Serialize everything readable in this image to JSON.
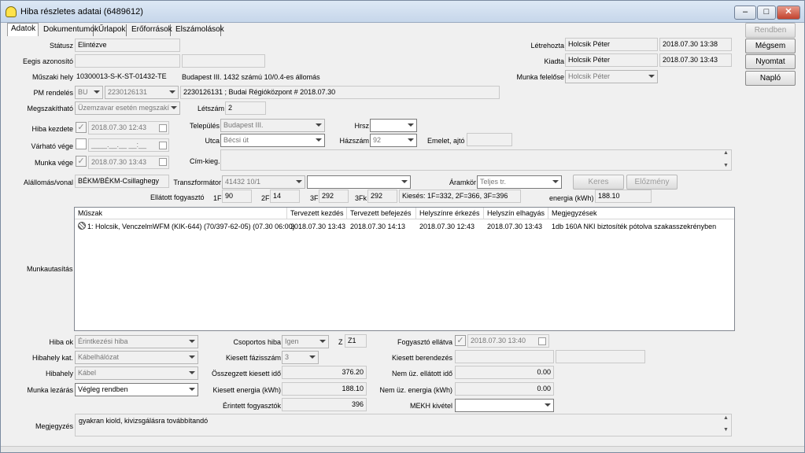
{
  "window": {
    "title": "Hiba részletes adatai (6489612)",
    "minimize": "–",
    "maximize": "□",
    "close": "✕"
  },
  "tabs": [
    "Adatok",
    "Dokumentumok",
    "Űrlapok",
    "Erőforrások",
    "Elszámolások"
  ],
  "side_buttons": {
    "ok": "Rendben",
    "cancel": "Mégsem",
    "print": "Nyomtat",
    "log": "Napló"
  },
  "form": {
    "status_label": "Státusz",
    "status_value": "Elintézve",
    "unique_id_label": "Eegis azonosító",
    "unique_id_value": "",
    "tech_place_label": "Műszaki hely",
    "tech_place_code": "10300013-S-K-ST-01432-TE",
    "tech_place_desc": "Budapest III. 1432 számú 10/0.4-es állomás",
    "pm_order_label": "PM rendelés",
    "pm_order_prefix": "BU",
    "pm_order_number": "2230126131",
    "pm_order_desc": "2230126131 ; Budai Régióközpont # 2018.07.30",
    "interruptible_label": "Megszakítható",
    "interruptible_value": "Üzemzavar esetén megszakí",
    "headcount_label": "Létszám",
    "headcount_value": "2",
    "created_by_label": "Létrehozta",
    "created_by_value": "Holcsik Péter",
    "created_at": "2018.07.30 13:38",
    "issued_by_label": "Kiadta",
    "issued_by_value": "Holcsik Péter",
    "issued_at": "2018.07.30 13:43",
    "work_resp_label": "Munka felelőse",
    "work_resp_value": "Holcsik Péter",
    "fault_start_label": "Hiba kezdete",
    "fault_start_value": "2018.07.30 12:43",
    "expected_end_label": "Várható vége",
    "expected_end_value": "____.__.__ __:__",
    "work_end_label": "Munka vége",
    "work_end_value": "2018.07.30 13:43",
    "settlement_label": "Település",
    "settlement_value": "Budapest III.",
    "hrsz_label": "Hrsz",
    "hrsz_value": "",
    "street_label": "Utca",
    "street_value": "Bécsi út",
    "house_no_label": "Házszám",
    "house_no_value": "92",
    "floor_door_label": "Emelet, ajtó",
    "floor_door_value": "",
    "address_extra_label": "Cím-kieg.",
    "address_extra_value": "",
    "substation_label": "Alállomás/vonal",
    "substation_value": "BÉKM/BÉKM-Csillaghegy",
    "transformer_label": "Transzformátor",
    "transformer_value": "41432 10/1",
    "transformer_second": "",
    "circuit_label": "Áramkör",
    "circuit_value": "Teljes tr.",
    "search_button": "Keres",
    "history_button": "Előzmény",
    "supplied_consumers_label": "Ellátott fogyasztó",
    "c1f_label": "1F",
    "c1f_value": "90",
    "c2f_label": "2F",
    "c2f_value": "14",
    "c3f_label": "3F",
    "c3f_value": "292",
    "c3fk_label": "3Fk",
    "c3fk_value": "292",
    "outage_summary": "Kiesés: 1F=332, 2F=366, 3F=396",
    "energy_label": "energia (kWh)",
    "energy_value": "188.10"
  },
  "work_assignment": {
    "label": "Munkautasítás",
    "columns": [
      "Műszak",
      "Tervezett kezdés",
      "Tervezett befejezés",
      "Helyszínre érkezés",
      "Helyszín elhagyás",
      "Megjegyzések"
    ],
    "rows": [
      [
        "1: Holcsik, VenczelmWFM (KIK-644) (70/397-62-05) (07.30 06:00)",
        "2018.07.30 13:43",
        "2018.07.30 14:13",
        "2018.07.30 12:43",
        "2018.07.30 13:43",
        "1db 160A NKI biztosíték pótolva szakasszekrényben"
      ]
    ]
  },
  "bottom": {
    "fault_cause_label": "Hiba ok",
    "fault_cause_value": "Érintkezési hiba",
    "location_cat_label": "Hibahely kat.",
    "location_cat_value": "Kábelhálózat",
    "location_label": "Hibahely",
    "location_value": "Kábel",
    "closure_label": "Munka lezárás",
    "closure_value": "Végleg rendben",
    "group_fault_label": "Csoportos hiba",
    "group_fault_value": "Igen",
    "z_label": "Z",
    "z_value": "Z1",
    "lost_phases_label": "Kiesett fázisszám",
    "lost_phases_value": "3",
    "total_lost_time_label": "Összegzett kiesett idő",
    "total_lost_time_value": "376.20",
    "lost_energy_label": "Kiesett energia (kWh)",
    "lost_energy_value": "188.10",
    "affected_consumers_label": "Érintett fogyasztók",
    "affected_consumers_value": "396",
    "consumer_supplied_label": "Fogyasztó ellátva",
    "consumer_supplied_value": "2018.07.30 13:40",
    "lost_device_label": "Kiesett berendezés",
    "lost_device_value": "",
    "non_op_time_label": "Nem üz. ellátott idő",
    "non_op_time_value": "0.00",
    "non_op_energy_label": "Nem üz. energia (kWh)",
    "non_op_energy_value": "0.00",
    "mekh_label": "MEKH kivétel",
    "mekh_value": "",
    "notes_label": "Megjegyzés",
    "notes_value": "gyakran kiold, kivizsgálásra továbbítandó"
  }
}
